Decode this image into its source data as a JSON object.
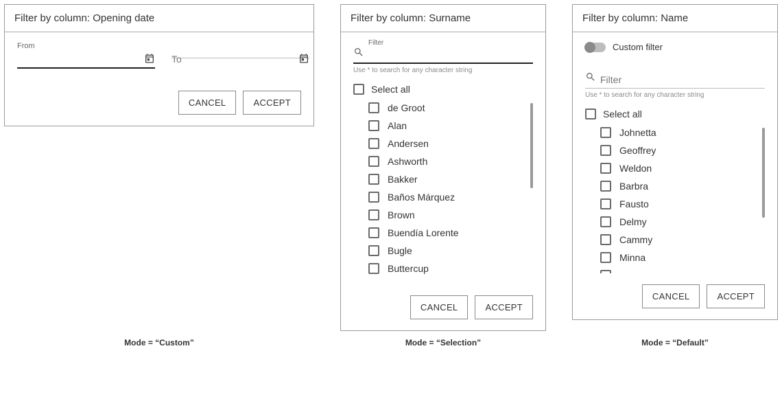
{
  "panel1": {
    "title": "Filter by column: Opening date",
    "from_label": "From",
    "to_label": "To",
    "from_value": "",
    "to_value": "",
    "cancel": "CANCEL",
    "accept": "ACCEPT",
    "caption": "Mode = “Custom”"
  },
  "panel2": {
    "title": "Filter by column: Surname",
    "filter_label": "Filter",
    "filter_value": "",
    "hint": "Use * to search for any character string",
    "select_all": "Select all",
    "items": {
      "0": "de Groot",
      "1": "Alan",
      "2": "Andersen",
      "3": "Ashworth",
      "4": "Bakker",
      "5": "Baños Márquez",
      "6": "Brown",
      "7": "Buendía Lorente",
      "8": "Bugle",
      "9": "Buttercup"
    },
    "cancel": "CANCEL",
    "accept": "ACCEPT",
    "caption": "Mode = “Selection”"
  },
  "panel3": {
    "title": "Filter by column: Name",
    "toggle_label": "Custom filter",
    "filter_placeholder": "Filter",
    "filter_value": "",
    "hint": "Use * to search for any character string",
    "select_all": "Select all",
    "items": {
      "0": "Johnetta",
      "1": "Geoffrey",
      "2": "Weldon",
      "3": "Barbra",
      "4": "Fausto",
      "5": "Delmy",
      "6": "Cammy",
      "7": "Minna"
    },
    "cancel": "CANCEL",
    "accept": "ACCEPT",
    "caption": "Mode = “Default”"
  }
}
